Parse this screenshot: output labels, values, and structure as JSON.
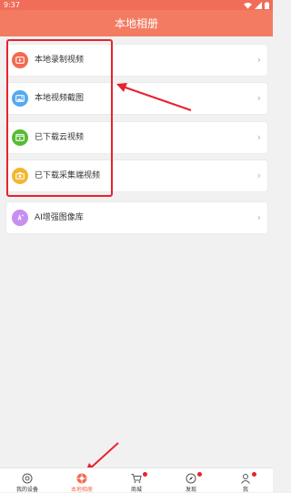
{
  "status_bar": {
    "time": "9:37"
  },
  "app_bar": {
    "title": "本地相册"
  },
  "items": [
    {
      "label": "本地录制视频",
      "icon": "video-record-icon",
      "color": "#f26a51"
    },
    {
      "label": "本地视频截图",
      "icon": "screenshot-image-icon",
      "color": "#55a9ef"
    },
    {
      "label": "已下载云视频",
      "icon": "cloud-video-icon",
      "color": "#58bb34"
    },
    {
      "label": "已下载采集端视频",
      "icon": "capture-video-icon",
      "color": "#f3b630"
    },
    {
      "label": "AI增强图像库",
      "icon": "ai-enhance-icon",
      "color": "#c88ef0"
    }
  ],
  "chevron": "›",
  "bottom_nav": [
    {
      "label": "我的设备",
      "icon": "device-icon",
      "active": false,
      "badge": false
    },
    {
      "label": "本地相册",
      "icon": "album-icon",
      "active": true,
      "badge": false
    },
    {
      "label": "商城",
      "icon": "cart-icon",
      "active": false,
      "badge": true
    },
    {
      "label": "发现",
      "icon": "compass-icon",
      "active": false,
      "badge": true
    },
    {
      "label": "我",
      "icon": "profile-icon",
      "active": false,
      "badge": true
    }
  ],
  "colors": {
    "accent": "#f37b62",
    "highlight": "#e8222e",
    "badge": "#e8222e",
    "nav_active": "#f26a51"
  }
}
